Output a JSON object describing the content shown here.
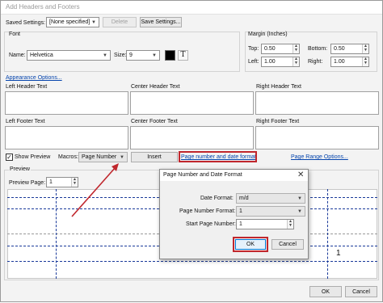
{
  "window": {
    "title": "Add Headers and Footers"
  },
  "saved": {
    "label": "Saved Settings:",
    "value": "[None specified]",
    "delete_label": "Delete",
    "save_label": "Save Settings..."
  },
  "font": {
    "group_label": "Font",
    "name_label": "Name:",
    "name_value": "Helvetica",
    "size_label": "Size:",
    "size_value": "9",
    "color": "#000000",
    "color_icon": "font-color-swatch",
    "text_icon": "text-format-icon"
  },
  "margin": {
    "group_label": "Margin (Inches)",
    "top_label": "Top:",
    "top_value": "0.50",
    "bottom_label": "Bottom:",
    "bottom_value": "0.50",
    "left_label": "Left:",
    "left_value": "1.00",
    "right_label": "Right:",
    "right_value": "1.00"
  },
  "appearance_link": "Appearance Options...",
  "header": {
    "left": "Left Header Text",
    "center": "Center Header Text",
    "right": "Right Header Text"
  },
  "footer": {
    "left": "Left Footer Text",
    "center": "Center Footer Text",
    "right": "Right Footer Text"
  },
  "controls": {
    "show_preview_label": "Show Preview",
    "show_preview_checked": true,
    "macros_label": "Macros:",
    "macros_value": "Page Number",
    "insert_label": "Insert",
    "page_format_link": "Page number and date format",
    "page_range_link": "Page Range Options..."
  },
  "preview": {
    "group_label": "Preview",
    "page_label": "Preview Page:",
    "page_value": "1",
    "page_number_shown": "1"
  },
  "dialog": {
    "title": "Page Number and Date Format",
    "close_icon": "close-icon",
    "date_format_label": "Date Format:",
    "date_format_value": "m/d",
    "page_number_format_label": "Page Number Format:",
    "page_number_format_value": "1",
    "start_page_label": "Start Page Number:",
    "start_page_value": "1",
    "ok_label": "OK",
    "cancel_label": "Cancel"
  },
  "footer_buttons": {
    "ok_label": "OK",
    "cancel_label": "Cancel"
  },
  "annotation_color": "#c0272d"
}
